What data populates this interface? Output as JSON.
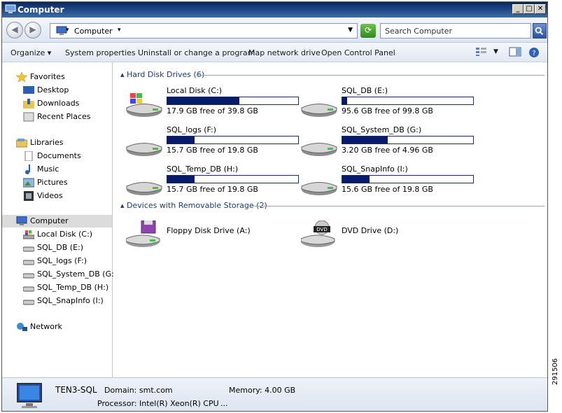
{
  "window": {
    "title": "Computer"
  },
  "address": {
    "path": "Computer",
    "search_placeholder": "Search Computer"
  },
  "commands": [
    "Organize",
    "System properties",
    "Uninstall or change a program",
    "Map network drive",
    "Open Control Panel"
  ],
  "nav": {
    "favorites": {
      "label": "Favorites",
      "items": [
        "Desktop",
        "Downloads",
        "Recent Places"
      ]
    },
    "libraries": {
      "label": "Libraries",
      "items": [
        "Documents",
        "Music",
        "Pictures",
        "Videos"
      ]
    },
    "computer": {
      "label": "Computer",
      "items": [
        "Local Disk (C:)",
        "SQL_DB (E:)",
        "SQL_logs (F:)",
        "SQL_System_DB (G:)",
        "SQL_Temp_DB (H:)",
        "SQL_SnapInfo (I:)"
      ]
    },
    "network": {
      "label": "Network"
    }
  },
  "groups": {
    "hard_disk": {
      "label": "Hard Disk Drives (6)"
    },
    "removable": {
      "label": "Devices with Removable Storage (2)"
    }
  },
  "drives": [
    {
      "name": "Local Disk (C:)",
      "free": "17.9 GB free of 39.8 GB",
      "used_fraction": 0.55,
      "icon": "windows-drive-icon"
    },
    {
      "name": "SQL_DB (E:)",
      "free": "95.6 GB free of 99.8 GB",
      "used_fraction": 0.04,
      "icon": "hard-drive-icon"
    },
    {
      "name": "SQL_logs (F:)",
      "free": "15.7 GB free of 19.8 GB",
      "used_fraction": 0.21,
      "icon": "hard-drive-icon"
    },
    {
      "name": "SQL_System_DB (G:)",
      "free": "3.20 GB free of 4.96 GB",
      "used_fraction": 0.35,
      "icon": "hard-drive-icon"
    },
    {
      "name": "SQL_Temp_DB (H:)",
      "free": "15.7 GB free of 19.8 GB",
      "used_fraction": 0.21,
      "icon": "hard-drive-icon"
    },
    {
      "name": "SQL_SnapInfo (I:)",
      "free": "15.6 GB free of 19.8 GB",
      "used_fraction": 0.21,
      "icon": "hard-drive-icon"
    }
  ],
  "removable": [
    {
      "name": "Floppy Disk Drive (A:)",
      "icon": "floppy-drive-icon"
    },
    {
      "name": "DVD Drive (D:)",
      "icon": "dvd-drive-icon",
      "badge": "DVD"
    }
  ],
  "details": {
    "computer_name": "TEN3-SQL",
    "domain": "Domain: smt.com",
    "memory": "Memory: 4.00 GB",
    "processor": "Processor: Intel(R) Xeon(R) CPU",
    "ellipsis": "..."
  },
  "figure_id": "291506",
  "colors": {
    "usage_bar": "#061a6e",
    "title_bar": "#0a246a"
  }
}
